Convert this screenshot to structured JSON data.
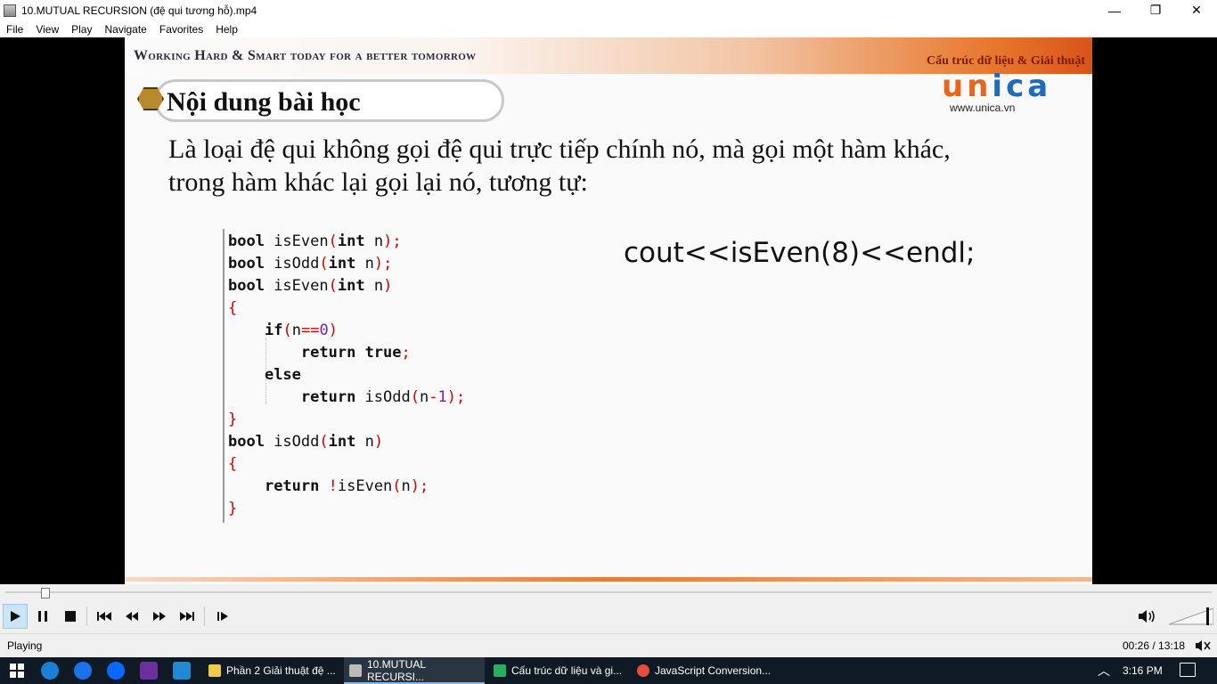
{
  "window": {
    "title": "10.MUTUAL RECURSION (đệ qui tương hỗ).mp4",
    "minimize": "—",
    "maximize": "❐",
    "close": "✕"
  },
  "menu": {
    "items": [
      "File",
      "View",
      "Play",
      "Navigate",
      "Favorites",
      "Help"
    ]
  },
  "slide": {
    "slogan": "Working Hard & Smart today for a better tomorrow",
    "subject": "Cấu trúc dữ liệu & Giải thuật",
    "brand_part1": "un",
    "brand_part2": "ica",
    "site": "www.unica.vn",
    "heading": "Nội dung bài học",
    "paragraph_line1": "Là loại đệ qui không gọi đệ qui trực tiếp chính nó, mà gọi một hàm khác,",
    "paragraph_line2": "trong hàm khác lại gọi lại nó, tương tự:",
    "cout": "cout<<isEven(8)<<endl;"
  },
  "code_lines": [
    "bool isEven(int n);",
    "bool isOdd(int n);",
    "bool isEven(int n)",
    "{",
    "    if(n==0)",
    "        return true;",
    "    else",
    "        return isOdd(n-1);",
    "}",
    "bool isOdd(int n)",
    "{",
    "    return !isEven(n);",
    "}"
  ],
  "player": {
    "progress": 0.033,
    "status": "Playing",
    "time": "00:26 / 13:18",
    "volume": 0.9
  },
  "taskbar": {
    "tasks": [
      {
        "label": "Phần 2 Giải thuật đệ ...",
        "color": "#f2c94c"
      },
      {
        "label": "10.MUTUAL RECURSI...",
        "color": "#bbbbbb"
      },
      {
        "label": "Cấu trúc dữ liệu và gi...",
        "color": "#27ae60"
      },
      {
        "label": "JavaScript Conversion...",
        "color": "#e74c3c"
      }
    ],
    "clock": "3:16 PM"
  }
}
